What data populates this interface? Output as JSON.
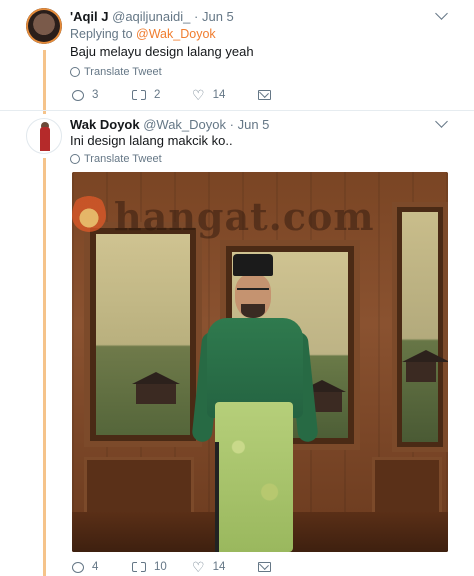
{
  "tweet1": {
    "display_name": "'Aqil J",
    "handle": "@aqiljunaidi_",
    "sep": "·",
    "date": "Jun 5",
    "replying_prefix": "Replying to",
    "replying_to": "@Wak_Doyok",
    "text": "Baju melayu design lalang yeah",
    "translate": "Translate Tweet",
    "stats": {
      "replies": "3",
      "retweets": "2",
      "likes": "14"
    }
  },
  "tweet2": {
    "display_name": "Wak Doyok",
    "handle": "@Wak_Doyok",
    "sep": "·",
    "date": "Jun 5",
    "text": "Ini design lalang makcik ko..",
    "translate": "Translate Tweet",
    "watermark": "hangat.com",
    "stats": {
      "replies": "4",
      "retweets": "10",
      "likes": "14"
    }
  },
  "colors": {
    "accent": "#f07d2f",
    "muted": "#657786",
    "thread": "#f5c38a"
  },
  "icons": [
    "globe-icon",
    "reply-icon",
    "retweet-icon",
    "like-icon",
    "dm-icon",
    "chevron-down-icon"
  ]
}
